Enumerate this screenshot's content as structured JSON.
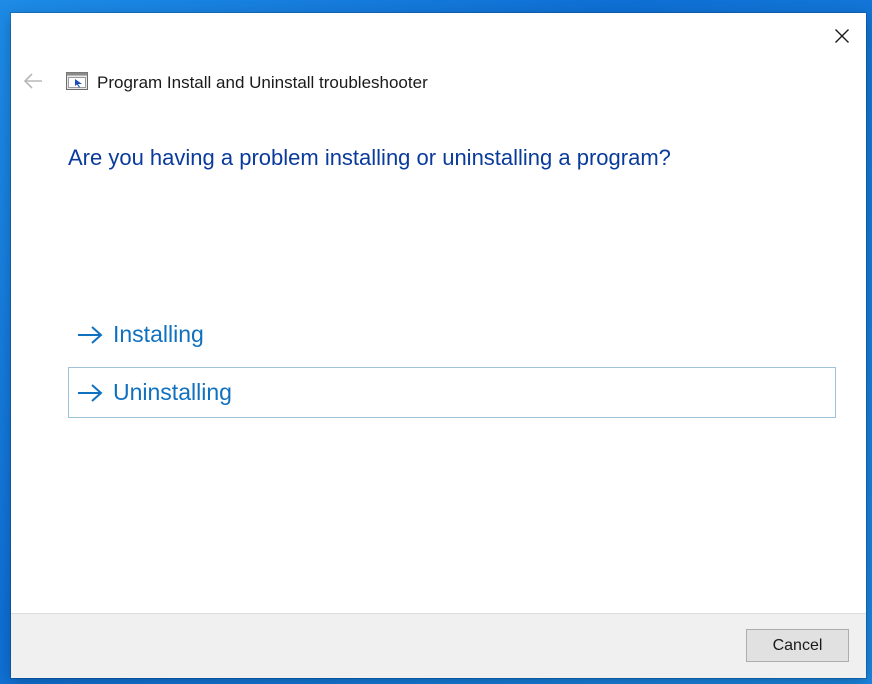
{
  "window": {
    "title": "Program Install and Uninstall troubleshooter"
  },
  "main": {
    "question": "Are you having a problem installing or uninstalling a program?",
    "options": [
      {
        "label": "Installing"
      },
      {
        "label": "Uninstalling"
      }
    ]
  },
  "footer": {
    "cancel_label": "Cancel"
  },
  "icons": {
    "close": "close-icon",
    "back": "back-arrow-icon",
    "app": "troubleshooter-app-icon",
    "option_arrow": "right-arrow-icon"
  },
  "colors": {
    "heading": "#0a3b9b",
    "link": "#1070c0",
    "focus_border": "#9fc2d8",
    "desktop": "#1d8be6"
  }
}
